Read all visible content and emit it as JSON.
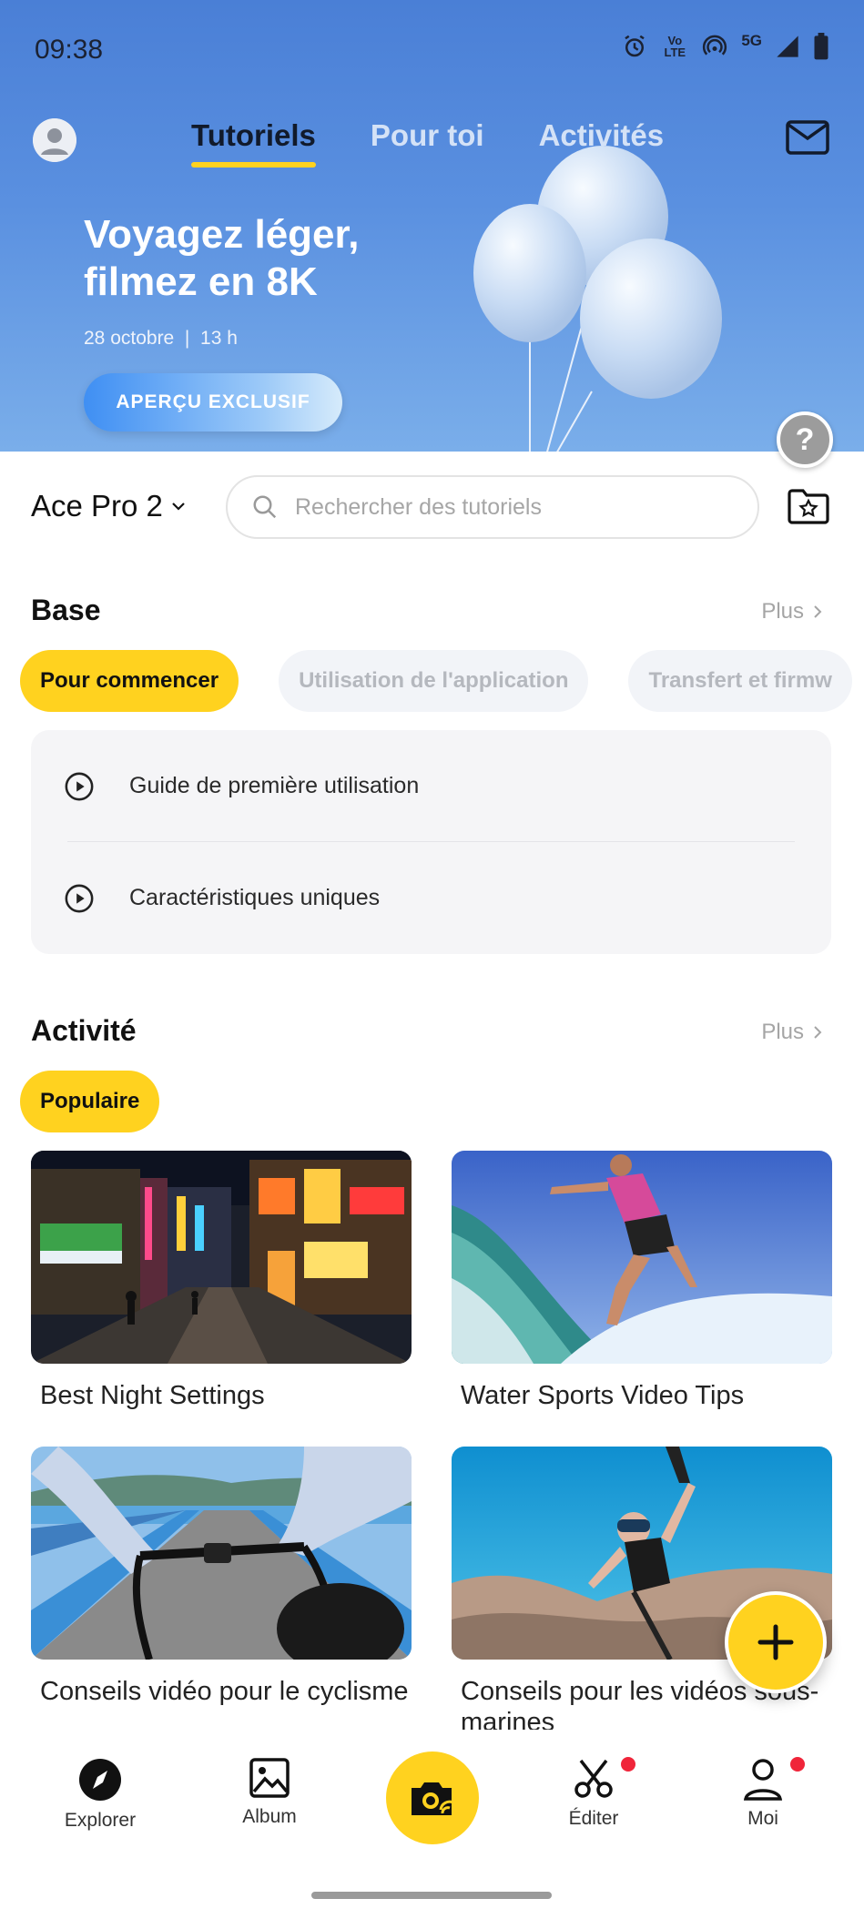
{
  "status_bar": {
    "time": "09:38",
    "volte": "Vo LTE",
    "network": "5G"
  },
  "top_tabs": [
    {
      "label": "Tutoriels",
      "active": true
    },
    {
      "label": "Pour toi",
      "active": false
    },
    {
      "label": "Activités",
      "active": false
    }
  ],
  "hero": {
    "title": "Voyagez léger, filmez en 8K",
    "date": "28 octobre  |  13 h",
    "cta": "APERÇU EXCLUSIF"
  },
  "help_label": "?",
  "device": {
    "name": "Ace Pro 2"
  },
  "search": {
    "placeholder": "Rechercher des tutoriels"
  },
  "base": {
    "title": "Base",
    "more": "Plus",
    "chips": [
      "Pour commencer",
      "Utilisation de l'application",
      "Transfert et firmw"
    ],
    "items": [
      "Guide de première utilisation",
      "Caractéristiques uniques"
    ]
  },
  "activity": {
    "title": "Activité",
    "more": "Plus",
    "chip": "Populaire",
    "cards": [
      {
        "title": "Best Night Settings"
      },
      {
        "title": "Water Sports Video Tips"
      },
      {
        "title": "Conseils vidéo pour le cyclisme"
      },
      {
        "title": "Conseils pour les vidéos sous-marines"
      }
    ]
  },
  "bottom_nav": {
    "explorer": "Explorer",
    "album": "Album",
    "edit": "Éditer",
    "me": "Moi"
  },
  "colors": {
    "accent": "#ffd21f",
    "hero_blue": "#4a7fd6",
    "badge_red": "#f0253a"
  }
}
